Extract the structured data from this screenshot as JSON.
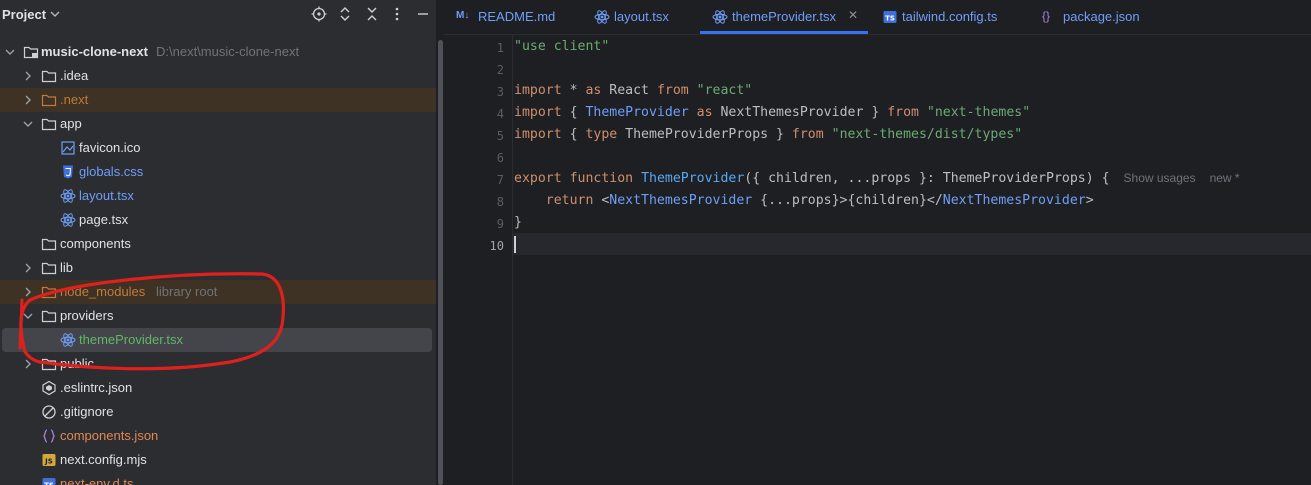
{
  "sidebar": {
    "title": "Project",
    "rows": [
      {
        "label": "music-clone-next",
        "hint": "D:\\next\\music-clone-next",
        "color": "default",
        "bold": true,
        "icon": "module-folder-icon",
        "expanded": true
      },
      {
        "label": ".idea",
        "hint": "",
        "color": "default",
        "icon": "folder-icon",
        "expanded": false
      },
      {
        "label": ".next",
        "hint": "",
        "color": "excluded",
        "icon": "excluded-folder-icon",
        "expanded": false
      },
      {
        "label": "app",
        "hint": "",
        "color": "default",
        "icon": "folder-icon",
        "expanded": true
      },
      {
        "label": "favicon.ico",
        "hint": "",
        "color": "default",
        "icon": "image-file-icon"
      },
      {
        "label": "globals.css",
        "hint": "",
        "color": "blue",
        "icon": "css-file-icon"
      },
      {
        "label": "layout.tsx",
        "hint": "",
        "color": "blue",
        "icon": "react-file-icon"
      },
      {
        "label": "page.tsx",
        "hint": "",
        "color": "default",
        "icon": "react-file-icon"
      },
      {
        "label": "components",
        "hint": "",
        "color": "default",
        "icon": "folder-icon"
      },
      {
        "label": "lib",
        "hint": "",
        "color": "default",
        "icon": "folder-icon",
        "expanded": false
      },
      {
        "label": "node_modules",
        "hint": "library root",
        "color": "excluded",
        "icon": "excluded-folder-icon",
        "expanded": false
      },
      {
        "label": "providers",
        "hint": "",
        "color": "default",
        "icon": "folder-icon",
        "expanded": true
      },
      {
        "label": "themeProvider.tsx",
        "hint": "",
        "color": "green",
        "icon": "react-file-icon"
      },
      {
        "label": "public",
        "hint": "",
        "color": "default",
        "icon": "folder-icon",
        "expanded": false
      },
      {
        "label": ".eslintrc.json",
        "hint": "",
        "color": "default",
        "icon": "eslint-file-icon"
      },
      {
        "label": ".gitignore",
        "hint": "",
        "color": "default",
        "icon": "gitignore-file-icon"
      },
      {
        "label": "components.json",
        "hint": "",
        "color": "orange",
        "icon": "json-file-icon"
      },
      {
        "label": "next.config.mjs",
        "hint": "",
        "color": "default",
        "icon": "js-file-icon"
      },
      {
        "label": "next-env.d.ts",
        "hint": "",
        "color": "orange",
        "icon": "ts-file-icon"
      }
    ]
  },
  "tabs": [
    {
      "label": "README.md",
      "icon": "markdown-icon",
      "badge": "M↓",
      "active": false,
      "closable": false
    },
    {
      "label": "layout.tsx",
      "icon": "react-icon",
      "active": false,
      "closable": false
    },
    {
      "label": "themeProvider.tsx",
      "icon": "react-icon",
      "active": true,
      "closable": true
    },
    {
      "label": "tailwind.config.ts",
      "icon": "typescript-icon",
      "badge": "TS",
      "active": false,
      "closable": false
    },
    {
      "label": "package.json",
      "icon": "json-braces-icon",
      "badge": "{}",
      "active": false,
      "closable": false
    }
  ],
  "editor": {
    "line_numbers": [
      "1",
      "2",
      "3",
      "4",
      "5",
      "6",
      "7",
      "8",
      "9",
      "10"
    ],
    "current_line": "10",
    "lines": [
      [
        {
          "t": "\"use client\"",
          "c": "str"
        }
      ],
      [],
      [
        {
          "t": "import",
          "c": "kw"
        },
        {
          "t": " * ",
          "c": "plain"
        },
        {
          "t": "as",
          "c": "kw"
        },
        {
          "t": " React ",
          "c": "plain"
        },
        {
          "t": "from",
          "c": "kw"
        },
        {
          "t": " ",
          "c": "plain"
        },
        {
          "t": "\"react\"",
          "c": "str"
        }
      ],
      [
        {
          "t": "import",
          "c": "kw"
        },
        {
          "t": " { ",
          "c": "plain"
        },
        {
          "t": "ThemeProvider",
          "c": "cls"
        },
        {
          "t": " ",
          "c": "plain"
        },
        {
          "t": "as",
          "c": "kw"
        },
        {
          "t": " NextThemesProvider } ",
          "c": "plain"
        },
        {
          "t": "from",
          "c": "kw"
        },
        {
          "t": " ",
          "c": "plain"
        },
        {
          "t": "\"next-themes\"",
          "c": "str"
        }
      ],
      [
        {
          "t": "import",
          "c": "kw"
        },
        {
          "t": " { ",
          "c": "plain"
        },
        {
          "t": "type",
          "c": "kw"
        },
        {
          "t": " ThemeProviderProps } ",
          "c": "plain"
        },
        {
          "t": "from",
          "c": "kw"
        },
        {
          "t": " ",
          "c": "plain"
        },
        {
          "t": "\"next-themes/dist/types\"",
          "c": "str"
        }
      ],
      [],
      [
        {
          "t": "export",
          "c": "kw"
        },
        {
          "t": " ",
          "c": "plain"
        },
        {
          "t": "function",
          "c": "kw"
        },
        {
          "t": " ",
          "c": "plain"
        },
        {
          "t": "ThemeProvider",
          "c": "fn"
        },
        {
          "t": "({ children, ...props }: ThemeProviderProps) {",
          "c": "plain"
        }
      ],
      [
        {
          "t": "    ",
          "c": "plain"
        },
        {
          "t": "return",
          "c": "kw"
        },
        {
          "t": " <",
          "c": "plain"
        },
        {
          "t": "NextThemesProvider",
          "c": "cls"
        },
        {
          "t": " {...props}>{children}</",
          "c": "plain"
        },
        {
          "t": "NextThemesProvider",
          "c": "cls"
        },
        {
          "t": ">",
          "c": "plain"
        }
      ],
      [
        {
          "t": "}",
          "c": "plain"
        }
      ],
      []
    ],
    "inlay_hint_usages": "Show usages",
    "inlay_hint_new": "new *"
  },
  "colors": {
    "accent": "#3574f0",
    "annotation": "#e0201c"
  }
}
